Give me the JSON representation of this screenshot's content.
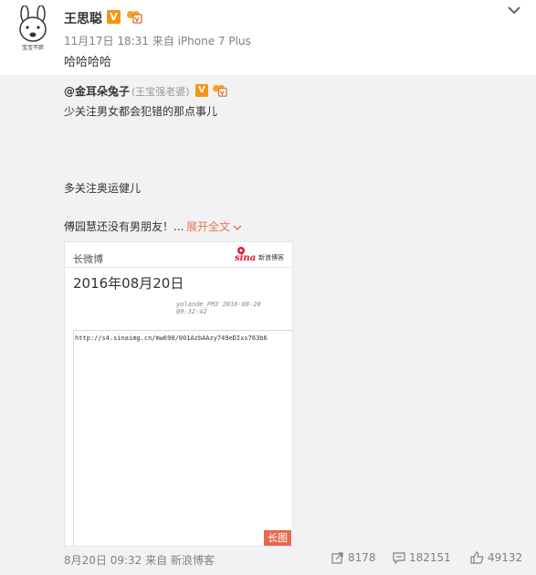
{
  "post": {
    "author": "王思聪",
    "avatar_caption": "宝宝不胖",
    "vip_icon": "v-verified-badge",
    "vip_letter": "V",
    "meta": "11月17日 18:31 来自 iPhone 7 Plus",
    "text": "哈哈哈哈",
    "menu_icon": "chevron-down-icon"
  },
  "repost": {
    "author": "@金耳朵兔子",
    "remark": "(王宝强老婆)",
    "vip_letter": "V",
    "line1": "少关注男女都会犯错的那点事儿",
    "line2": "多关注奥运健儿",
    "line3": "傅园慧还没有男朋友！...",
    "expand_label": "展开全文",
    "expand_icon": "chevron-down-icon",
    "card": {
      "header_title": "长微博",
      "logo_text": "sina",
      "logo_sub": "新浪博客",
      "date": "2016年08月20日",
      "author_line": "yolande_FM3 2016-08-20 09:32:42",
      "url": "http://s4.sinaimg.cn/mw690/001AzbAAzy749eDIxs763b6",
      "badge": "长图"
    }
  },
  "footer": {
    "meta": "8月20日 09:32 来自 新浪博客",
    "reposts": "8178",
    "comments": "182151",
    "likes": "49132"
  },
  "colors": {
    "accent": "#eb7350",
    "vip": "#f79410",
    "repost_bg": "#f2f2f5"
  }
}
